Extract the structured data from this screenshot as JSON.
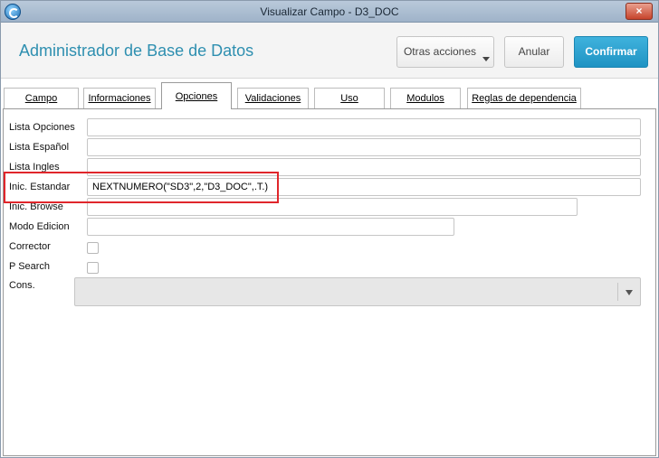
{
  "window": {
    "title": "Visualizar Campo - D3_DOC",
    "close_label": "×"
  },
  "header": {
    "app_title": "Administrador de Base de Datos",
    "buttons": {
      "otras": "Otras acciones",
      "anular": "Anular",
      "confirmar": "Confirmar"
    }
  },
  "tabs": [
    "Campo",
    "Informaciones",
    "Opciones",
    "Validaciones",
    "Uso",
    "Modulos",
    "Reglas de dependencia"
  ],
  "active_tab": "Opciones",
  "form": {
    "lista_opciones": {
      "label": "Lista Opciones",
      "value": ""
    },
    "lista_espanol": {
      "label": "Lista Español",
      "value": ""
    },
    "lista_ingles": {
      "label": "Lista Ingles",
      "value": ""
    },
    "inic_estandar": {
      "label": "Inic. Estandar",
      "value": "NEXTNUMERO(\"SD3\",2,\"D3_DOC\",.T.)"
    },
    "inic_browse": {
      "label": "Inic. Browse",
      "value": ""
    },
    "modo_edicion": {
      "label": "Modo Edicion",
      "value": ""
    },
    "corrector": {
      "label": "Corrector",
      "checked": false
    },
    "p_search": {
      "label": "P Search",
      "checked": false
    },
    "cons": {
      "label": "Cons.",
      "value": ""
    }
  },
  "colors": {
    "accent": "#2e8fb0",
    "confirm": "#1f93c3",
    "highlight": "#e0262b"
  }
}
